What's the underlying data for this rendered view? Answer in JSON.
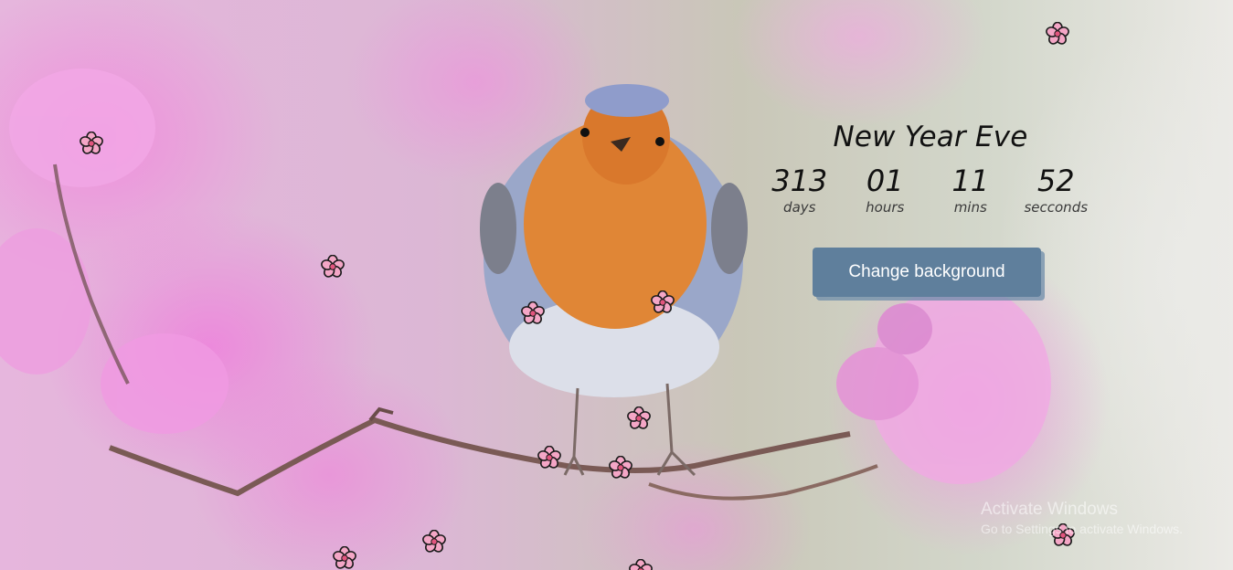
{
  "countdown": {
    "title": "New Year Eve",
    "days": {
      "value": "313",
      "label": "days"
    },
    "hours": {
      "value": "01",
      "label": "hours"
    },
    "mins": {
      "value": "11",
      "label": "mins"
    },
    "seconds": {
      "value": "52",
      "label": "secconds"
    }
  },
  "change_background_label": "Change background",
  "watermark": {
    "line1": "Activate Windows",
    "line2": "Go to Settings to activate Windows."
  },
  "petal_icon": "cherry-blossom-icon",
  "colors": {
    "button_bg": "#5f7f9c",
    "petal_fill": "#f4a6c6",
    "petal_outline": "#1a1a1a"
  }
}
